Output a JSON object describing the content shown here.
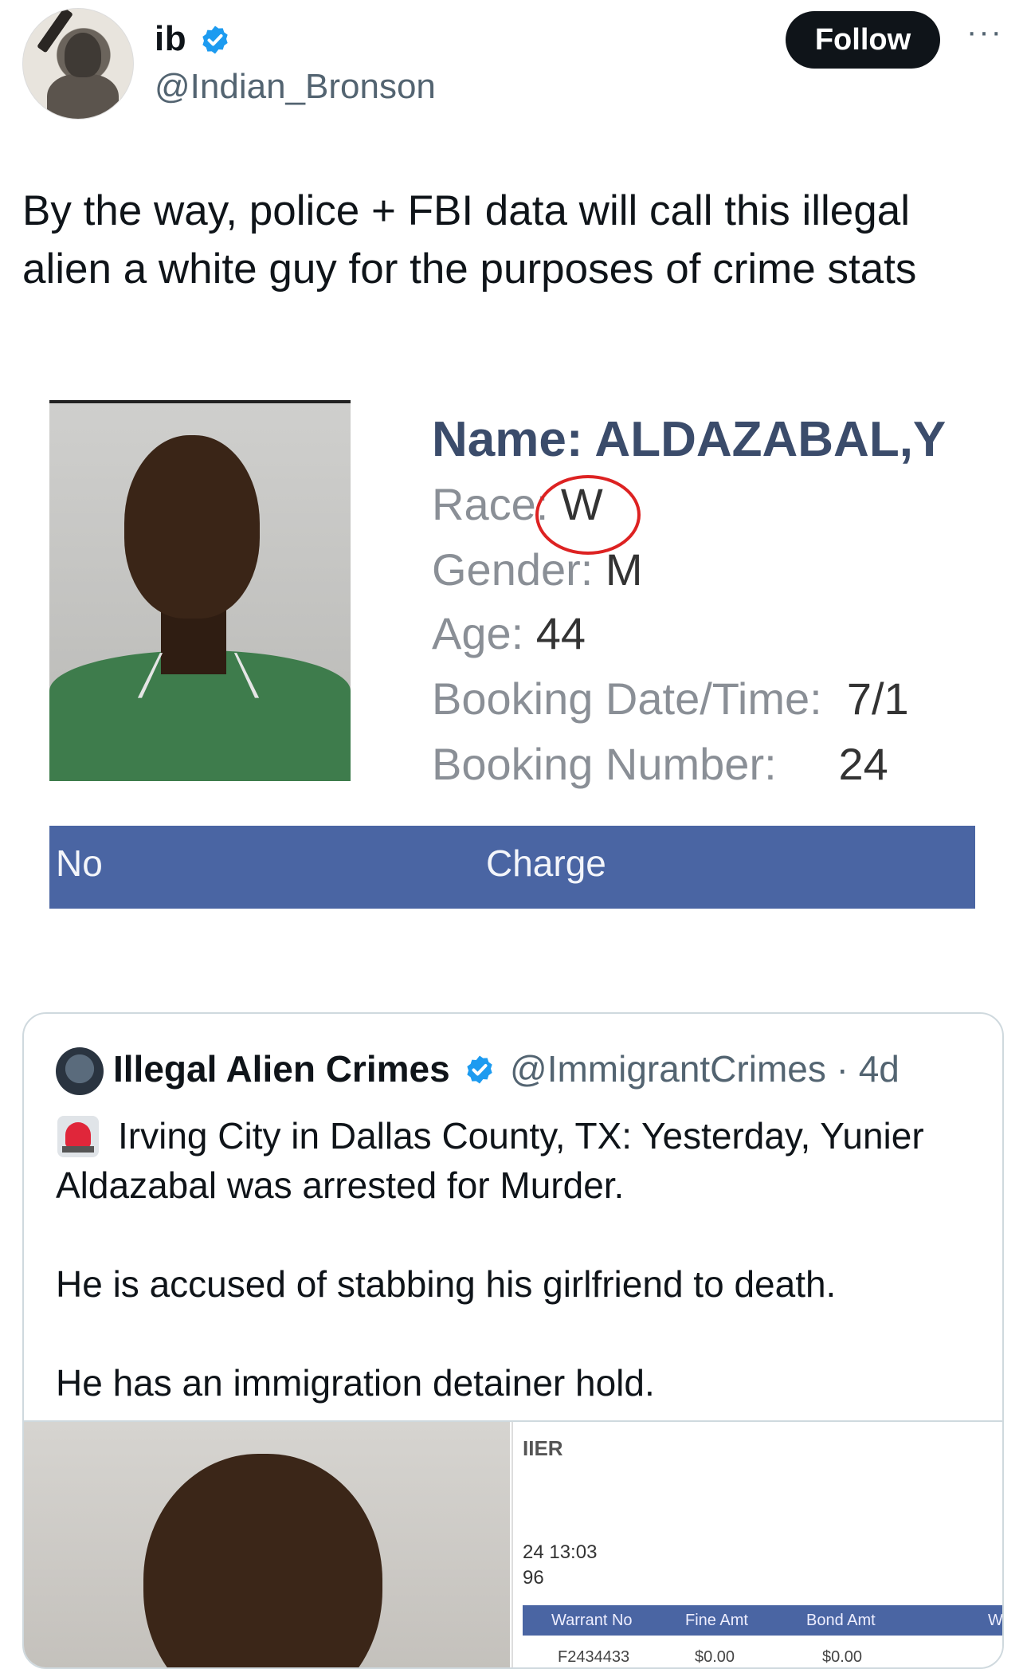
{
  "author": {
    "display_name": "ib",
    "handle": "@Indian_Bronson",
    "follow_label": "Follow",
    "more_label": "···"
  },
  "tweet": {
    "text": "By the way, police + FBI data will call this illegal alien a white guy for the purposes of crime stats"
  },
  "media": {
    "name_line": "Name: ALDAZABAL,Y",
    "race_label": "Race:",
    "race_value": "W",
    "gender_label": "Gender:",
    "gender_value": "M",
    "age_label": "Age:",
    "age_value": "44",
    "booking_dt_label": "Booking Date/Time:",
    "booking_dt_value": "7/1",
    "booking_no_label": "Booking Number:",
    "booking_no_value": "24",
    "charge_no": "No",
    "charge_label": "Charge"
  },
  "quote": {
    "name": "Illegal Alien Crimes",
    "handle": "@ImmigrantCrimes",
    "time": "· 4d",
    "line1": "Irving City in Dallas County, TX: Yesterday, Yunier Aldazabal was arrested for Murder.",
    "line2": "He is accused of stabbing his girlfriend to death.",
    "line3": "He has an immigration detainer hold.",
    "doc": {
      "title": "IIER",
      "dt": "24  13:03",
      "num": "96",
      "headers": [
        "Warrant No",
        "Fine Amt",
        "Bond Amt",
        "W"
      ],
      "row": [
        "F2434433",
        "$0.00",
        "$0.00"
      ]
    }
  },
  "colors": {
    "verified": "#1d9bf0",
    "follow_bg": "#0f1419",
    "charge_bar": "#4a65a3",
    "race_circle": "#dd2222"
  }
}
